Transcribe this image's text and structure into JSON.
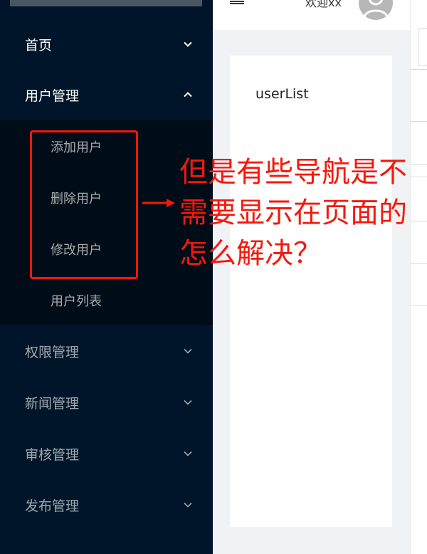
{
  "sidebar": {
    "menu": [
      {
        "label": "首页",
        "expanded": false
      },
      {
        "label": "用户管理",
        "expanded": true
      },
      {
        "label": "权限管理",
        "expanded": false
      },
      {
        "label": "新闻管理",
        "expanded": false
      },
      {
        "label": "审核管理",
        "expanded": false
      },
      {
        "label": "发布管理",
        "expanded": false
      }
    ],
    "user_submenu": [
      {
        "label": "添加用户"
      },
      {
        "label": "删除用户"
      },
      {
        "label": "修改用户"
      },
      {
        "label": "用户列表"
      }
    ]
  },
  "header": {
    "welcome": "欢迎xx"
  },
  "content": {
    "text": "userList"
  },
  "annotation": {
    "question": "但是有些导航是不需要显示在页面的怎么解决？",
    "color": "#f5180b"
  },
  "colors": {
    "sidebar_bg": "#001529",
    "submenu_bg": "#000c17",
    "page_bg": "#f0f2f5"
  }
}
